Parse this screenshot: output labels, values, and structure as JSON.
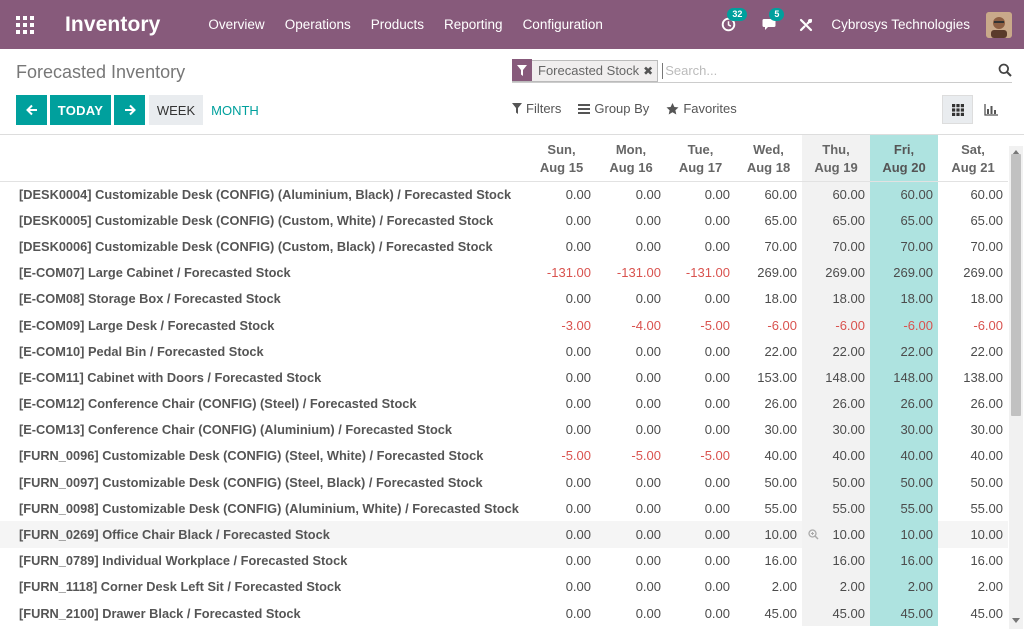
{
  "navbar": {
    "brand": "Inventory",
    "menu": [
      "Overview",
      "Operations",
      "Products",
      "Reporting",
      "Configuration"
    ],
    "activity_count": "32",
    "message_count": "5",
    "company": "Cybrosys Technologies"
  },
  "control": {
    "title": "Forecasted Inventory",
    "facet_label": "Forecasted Stock",
    "facet_remove": "✖",
    "search_placeholder": "Search...",
    "today_label": "TODAY",
    "week_label": "WEEK",
    "month_label": "MONTH",
    "filters_label": "Filters",
    "groupby_label": "Group By",
    "favorites_label": "Favorites"
  },
  "grid": {
    "columns": [
      {
        "day": "Sun,",
        "date": "Aug 15"
      },
      {
        "day": "Mon,",
        "date": "Aug 16"
      },
      {
        "day": "Tue,",
        "date": "Aug 17"
      },
      {
        "day": "Wed,",
        "date": "Aug 18"
      },
      {
        "day": "Thu,",
        "date": "Aug 19"
      },
      {
        "day": "Fri,",
        "date": "Aug 20"
      },
      {
        "day": "Sat,",
        "date": "Aug 21"
      }
    ],
    "rows": [
      {
        "product": "[DESK0004] Customizable Desk (CONFIG) (Aluminium, Black)",
        "sep": " / ",
        "state": "Forecasted Stock",
        "values": [
          "0.00",
          "0.00",
          "0.00",
          "60.00",
          "60.00",
          "60.00",
          "60.00"
        ]
      },
      {
        "product": "[DESK0005] Customizable Desk (CONFIG) (Custom, White)",
        "sep": " / ",
        "state": "Forecasted Stock",
        "values": [
          "0.00",
          "0.00",
          "0.00",
          "65.00",
          "65.00",
          "65.00",
          "65.00"
        ]
      },
      {
        "product": "[DESK0006] Customizable Desk (CONFIG) (Custom, Black)",
        "sep": " / ",
        "state": "Forecasted Stock",
        "values": [
          "0.00",
          "0.00",
          "0.00",
          "70.00",
          "70.00",
          "70.00",
          "70.00"
        ]
      },
      {
        "product": "[E-COM07] Large Cabinet",
        "sep": " / ",
        "state": "Forecasted Stock",
        "values": [
          "-131.00",
          "-131.00",
          "-131.00",
          "269.00",
          "269.00",
          "269.00",
          "269.00"
        ]
      },
      {
        "product": "[E-COM08] Storage Box",
        "sep": " / ",
        "state": "Forecasted Stock",
        "values": [
          "0.00",
          "0.00",
          "0.00",
          "18.00",
          "18.00",
          "18.00",
          "18.00"
        ]
      },
      {
        "product": "[E-COM09] Large Desk",
        "sep": " / ",
        "state": "Forecasted Stock",
        "values": [
          "-3.00",
          "-4.00",
          "-5.00",
          "-6.00",
          "-6.00",
          "-6.00",
          "-6.00"
        ]
      },
      {
        "product": "[E-COM10] Pedal Bin",
        "sep": " / ",
        "state": "Forecasted Stock",
        "values": [
          "0.00",
          "0.00",
          "0.00",
          "22.00",
          "22.00",
          "22.00",
          "22.00"
        ]
      },
      {
        "product": "[E-COM11] Cabinet with Doors",
        "sep": " / ",
        "state": "Forecasted Stock",
        "values": [
          "0.00",
          "0.00",
          "0.00",
          "153.00",
          "148.00",
          "148.00",
          "138.00"
        ]
      },
      {
        "product": "[E-COM12] Conference Chair (CONFIG) (Steel)",
        "sep": " / ",
        "state": "Forecasted Stock",
        "values": [
          "0.00",
          "0.00",
          "0.00",
          "26.00",
          "26.00",
          "26.00",
          "26.00"
        ]
      },
      {
        "product": "[E-COM13] Conference Chair (CONFIG) (Aluminium)",
        "sep": " / ",
        "state": "Forecasted Stock",
        "values": [
          "0.00",
          "0.00",
          "0.00",
          "30.00",
          "30.00",
          "30.00",
          "30.00"
        ]
      },
      {
        "product": "[FURN_0096] Customizable Desk (CONFIG) (Steel, White)",
        "sep": " / ",
        "state": "Forecasted Stock",
        "values": [
          "-5.00",
          "-5.00",
          "-5.00",
          "40.00",
          "40.00",
          "40.00",
          "40.00"
        ]
      },
      {
        "product": "[FURN_0097] Customizable Desk (CONFIG) (Steel, Black)",
        "sep": " / ",
        "state": "Forecasted Stock",
        "values": [
          "0.00",
          "0.00",
          "0.00",
          "50.00",
          "50.00",
          "50.00",
          "50.00"
        ]
      },
      {
        "product": "[FURN_0098] Customizable Desk (CONFIG) (Aluminium, White)",
        "sep": " / ",
        "state": "Forecasted Stock",
        "values": [
          "0.00",
          "0.00",
          "0.00",
          "55.00",
          "55.00",
          "55.00",
          "55.00"
        ]
      },
      {
        "product": "[FURN_0269] Office Chair Black",
        "sep": " / ",
        "state": "Forecasted Stock",
        "values": [
          "0.00",
          "0.00",
          "0.00",
          "10.00",
          "10.00",
          "10.00",
          "10.00"
        ]
      },
      {
        "product": "[FURN_0789] Individual Workplace",
        "sep": " / ",
        "state": "Forecasted Stock",
        "values": [
          "0.00",
          "0.00",
          "0.00",
          "16.00",
          "16.00",
          "16.00",
          "16.00"
        ]
      },
      {
        "product": "[FURN_1118] Corner Desk Left Sit",
        "sep": " / ",
        "state": "Forecasted Stock",
        "values": [
          "0.00",
          "0.00",
          "0.00",
          "2.00",
          "2.00",
          "2.00",
          "2.00"
        ]
      },
      {
        "product": "[FURN_2100] Drawer Black",
        "sep": " / ",
        "state": "Forecasted Stock",
        "values": [
          "0.00",
          "0.00",
          "0.00",
          "45.00",
          "45.00",
          "45.00",
          "45.00"
        ]
      }
    ],
    "hover_row": 13,
    "today_col": 5,
    "shaded_col": 4
  },
  "colors": {
    "navbar": "#875a7b",
    "primary": "#00a09d",
    "today_column": "#aee3e0",
    "negative": "#d9534f"
  }
}
